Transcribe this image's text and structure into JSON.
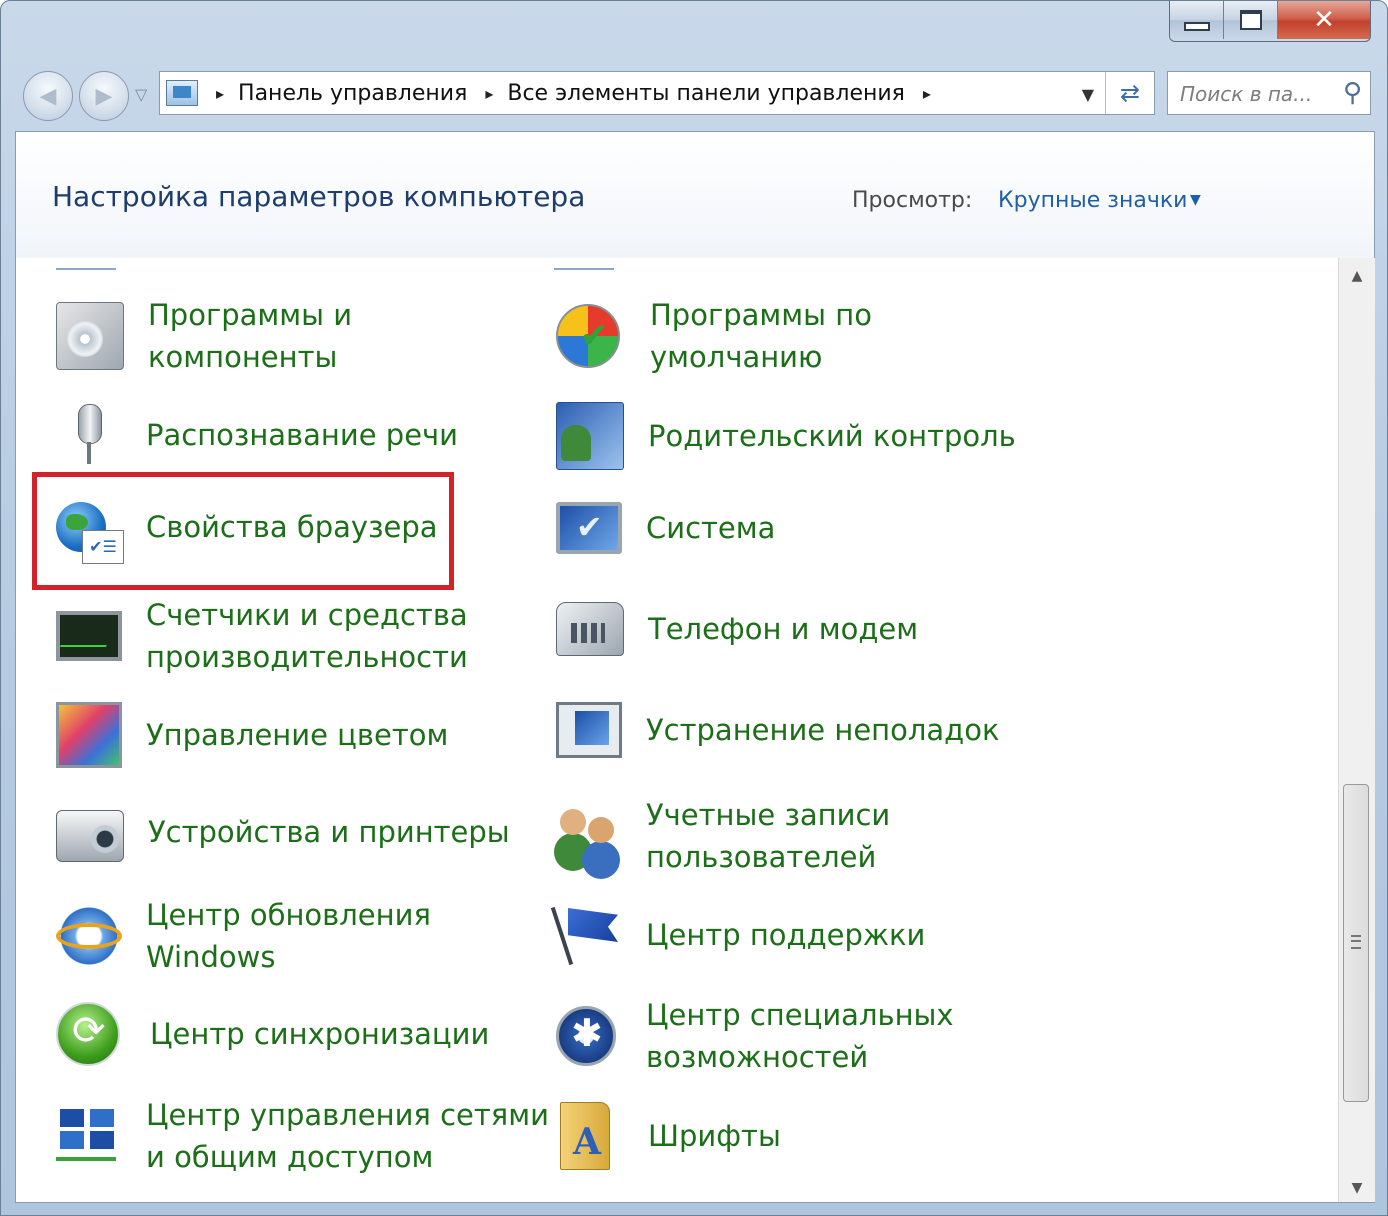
{
  "window": {
    "caption": {
      "min_label": "",
      "max_label": "",
      "close_label": "✕"
    }
  },
  "nav": {
    "back_glyph": "◀",
    "forward_glyph": "▶",
    "history_glyph": "▽",
    "breadcrumbs": [
      "Панель управления",
      "Все элементы панели управления"
    ],
    "separator": "▸",
    "refresh_glyph": "⇄",
    "search_placeholder": "Поиск в па..."
  },
  "header": {
    "title": "Настройка параметров компьютера",
    "view_label": "Просмотр:",
    "view_value": "Крупные значки",
    "view_arrow": "▼"
  },
  "items_left": [
    {
      "label": "Программы и\nкомпоненты",
      "icon": "programs-features-icon"
    },
    {
      "label": "Распознавание речи",
      "icon": "speech-recognition-icon"
    },
    {
      "label": "Свойства браузера",
      "icon": "internet-options-icon"
    },
    {
      "label": "Счетчики и средства\nпроизводительности",
      "icon": "performance-icon"
    },
    {
      "label": "Управление цветом",
      "icon": "color-management-icon"
    },
    {
      "label": "Устройства и принтеры",
      "icon": "devices-printers-icon"
    },
    {
      "label": "Центр обновления\nWindows",
      "icon": "windows-update-icon"
    },
    {
      "label": "Центр синхронизации",
      "icon": "sync-center-icon"
    },
    {
      "label": "Центр управления сетями\nи общим доступом",
      "icon": "network-center-icon"
    }
  ],
  "items_right": [
    {
      "label": "Программы по\nумолчанию",
      "icon": "default-programs-icon"
    },
    {
      "label": "Родительский контроль",
      "icon": "parental-controls-icon"
    },
    {
      "label": "Система",
      "icon": "system-icon"
    },
    {
      "label": "Телефон и модем",
      "icon": "phone-modem-icon"
    },
    {
      "label": "Устранение неполадок",
      "icon": "troubleshooting-icon"
    },
    {
      "label": "Учетные записи\nпользователей",
      "icon": "user-accounts-icon"
    },
    {
      "label": "Центр поддержки",
      "icon": "action-center-icon"
    },
    {
      "label": "Центр специальных\nвозможностей",
      "icon": "ease-of-access-icon"
    },
    {
      "label": "Шрифты",
      "icon": "fonts-icon"
    }
  ],
  "scrollbar": {
    "up": "▲",
    "down": "▼"
  },
  "colors": {
    "link_green": "#1c6f18",
    "title_blue": "#1e3d6b",
    "highlight_red": "#d3232a"
  }
}
